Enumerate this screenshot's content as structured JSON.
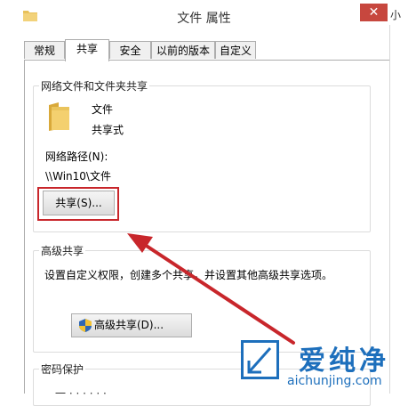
{
  "window": {
    "title": "文件 属性",
    "close_glyph": "✕",
    "right_fragment": "小"
  },
  "tabs": [
    {
      "label": "常规"
    },
    {
      "label": "共享"
    },
    {
      "label": "安全"
    },
    {
      "label": "以前的版本"
    },
    {
      "label": "自定义"
    }
  ],
  "network_sharing": {
    "group_title": "网络文件和文件夹共享",
    "folder_name": "文件",
    "share_status": "共享式",
    "path_label": "网络路径(N):",
    "path_value": "\\\\Win10\\文件",
    "share_button": "共享(S)..."
  },
  "advanced_sharing": {
    "group_title": "高级共享",
    "description": "设置自定义权限，创建多个共享，并设置其他高级共享选项。",
    "button": "高级共享(D)..."
  },
  "password_protection": {
    "group_title": "密码保护",
    "text_fragment": "一 ·  ·  ·  ·  ·  ·"
  },
  "watermark": {
    "text": "爱纯净",
    "url": "aichunjing.com"
  },
  "colors": {
    "highlight": "#c8262b",
    "arrow": "#c8262b",
    "watermark": "#1d6fbc"
  },
  "icons": {
    "title": "folder-icon",
    "folder": "folder-icon",
    "advanced_button": "shield-icon"
  }
}
